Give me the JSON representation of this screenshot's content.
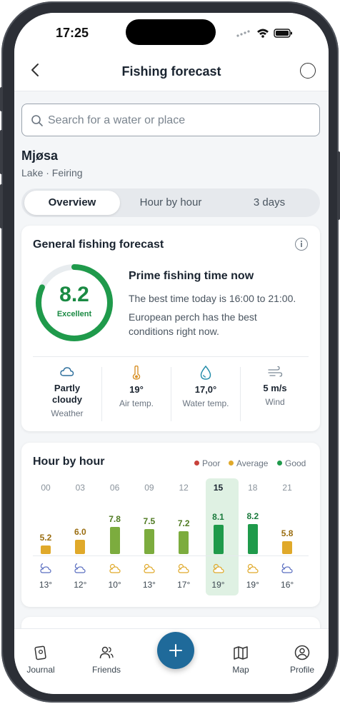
{
  "status_bar": {
    "time": "17:25"
  },
  "header": {
    "title": "Fishing forecast"
  },
  "search": {
    "placeholder": "Search for a water or place"
  },
  "place": {
    "name": "Mjøsa",
    "subtitle": "Lake · Feiring"
  },
  "tabs": [
    {
      "label": "Overview",
      "active": true
    },
    {
      "label": "Hour by hour",
      "active": false
    },
    {
      "label": "3 days",
      "active": false
    }
  ],
  "general": {
    "title": "General fishing forecast",
    "score": "8.2",
    "score_fraction": 0.82,
    "score_label": "Excellent",
    "prime_title": "Prime fishing time now",
    "line1": "The best time today is 16:00 to 21:00.",
    "line2": "European perch has the best",
    "line3": "conditions right now.",
    "metrics": [
      {
        "icon": "partly-cloudy-icon",
        "value": "Partly cloudy",
        "label": "Weather"
      },
      {
        "icon": "thermometer-icon",
        "value": "19°",
        "label": "Air temp."
      },
      {
        "icon": "water-drop-icon",
        "value": "17,0°",
        "label": "Water temp."
      },
      {
        "icon": "wind-icon",
        "value": "5 m/s",
        "label": "Wind"
      }
    ]
  },
  "hourly": {
    "title": "Hour by hour",
    "legend": [
      {
        "label": "Poor",
        "color": "#c8423b"
      },
      {
        "label": "Average",
        "color": "#e0a92a"
      },
      {
        "label": "Good",
        "color": "#1f9a4b"
      }
    ],
    "hours": [
      {
        "hour": "00",
        "value": "5.2",
        "rating": "average",
        "icon": "partly-cloudy-night-icon",
        "temp": "13°"
      },
      {
        "hour": "03",
        "value": "6.0",
        "rating": "average",
        "icon": "partly-cloudy-night-icon",
        "temp": "12°"
      },
      {
        "hour": "06",
        "value": "7.8",
        "rating": "good",
        "icon": "partly-cloudy-day-icon",
        "temp": "10°"
      },
      {
        "hour": "09",
        "value": "7.5",
        "rating": "good",
        "icon": "partly-cloudy-day-icon",
        "temp": "13°"
      },
      {
        "hour": "12",
        "value": "7.2",
        "rating": "good",
        "icon": "partly-cloudy-day-icon",
        "temp": "17°"
      },
      {
        "hour": "15",
        "value": "8.1",
        "rating": "excellent",
        "icon": "partly-cloudy-day-icon",
        "temp": "19°",
        "current": true
      },
      {
        "hour": "18",
        "value": "8.2",
        "rating": "excellent",
        "icon": "partly-cloudy-day-icon",
        "temp": "19°"
      },
      {
        "hour": "21",
        "value": "5.8",
        "rating": "average",
        "icon": "partly-cloudy-night-icon",
        "temp": "16°"
      }
    ]
  },
  "colors": {
    "accent": "#1f6a9a",
    "excellent": "#1f9a4b",
    "good": "#7cac3e",
    "average": "#e0a92a"
  },
  "tabbar": [
    {
      "icon": "journal-icon",
      "label": "Journal"
    },
    {
      "icon": "friends-icon",
      "label": "Friends"
    },
    {
      "icon": "add-icon",
      "label": ""
    },
    {
      "icon": "map-icon",
      "label": "Map"
    },
    {
      "icon": "profile-icon",
      "label": "Profile"
    }
  ]
}
